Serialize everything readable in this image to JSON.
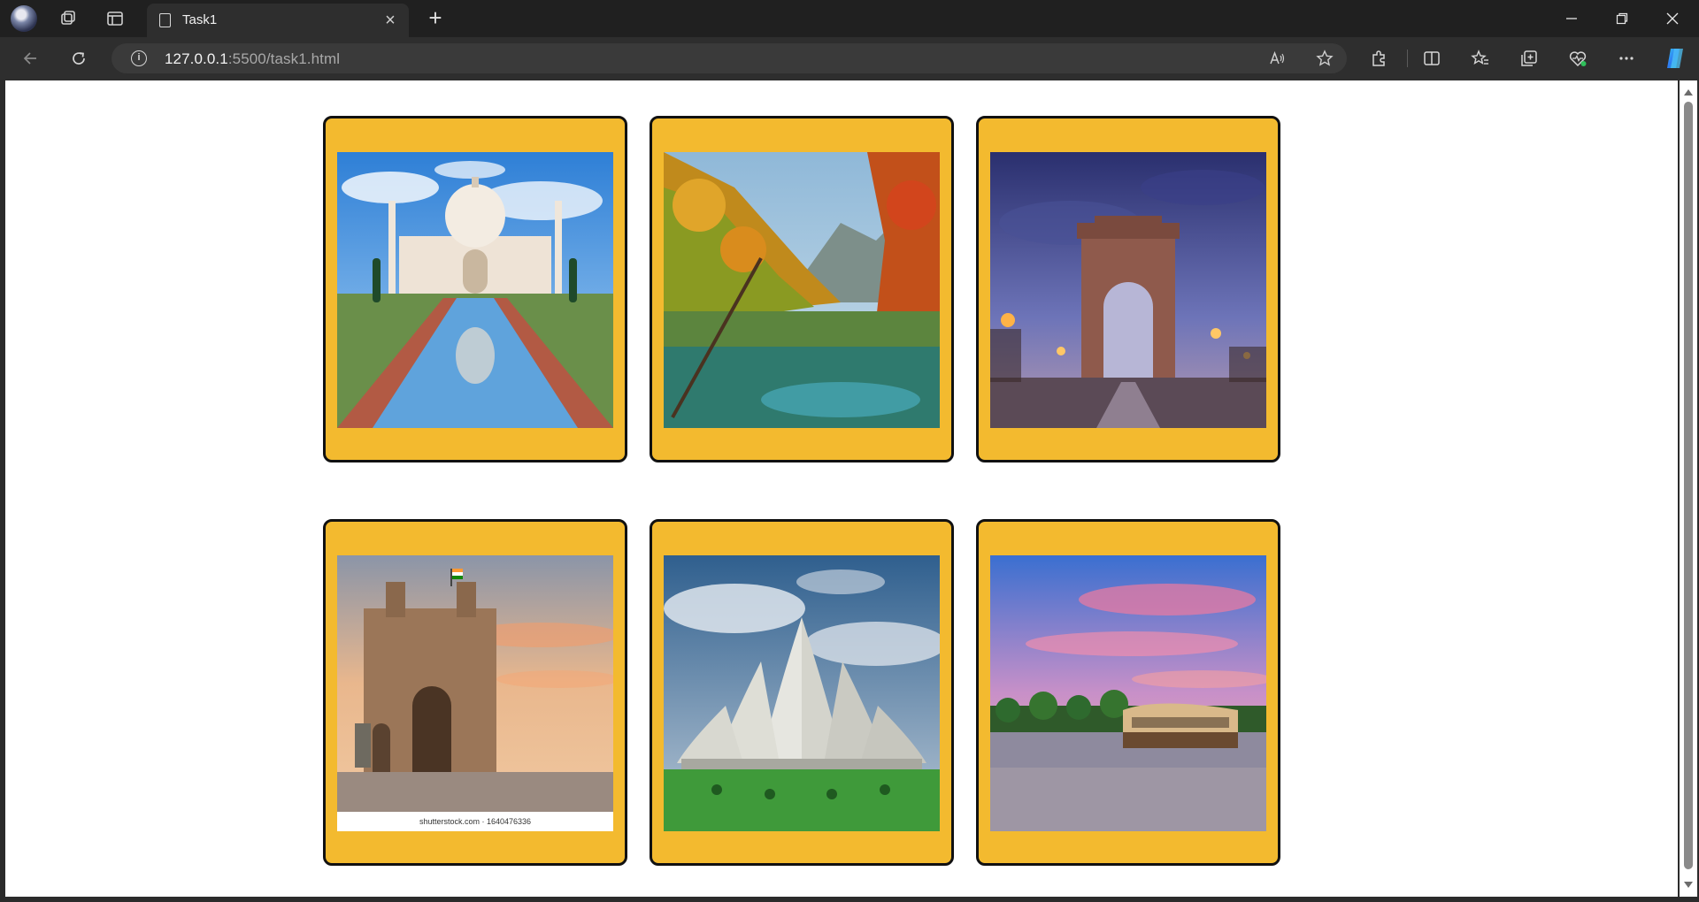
{
  "tab": {
    "title": "Task1"
  },
  "address": {
    "host": "127.0.0.1",
    "path": ":5500/task1.html"
  },
  "gallery": [
    {
      "subject": "Taj Mahal"
    },
    {
      "subject": "Autumn forest lake"
    },
    {
      "subject": "India Gate"
    },
    {
      "subject": "Gateway of India",
      "watermark": "shutterstock.com · 1640476336"
    },
    {
      "subject": "Lotus Temple"
    },
    {
      "subject": "Kerala backwater houseboat"
    }
  ],
  "colors": {
    "card_bg": "#f3ba2f",
    "card_border": "#111111",
    "page_bg": "#ffffff",
    "chrome_bg": "#202020"
  },
  "icons": [
    "profile-icon",
    "workspaces-icon",
    "tab-actions-icon",
    "page-icon",
    "close-icon",
    "plus-icon",
    "minimize-icon",
    "restore-icon",
    "close-window-icon",
    "back-arrow-icon",
    "refresh-icon",
    "info-icon",
    "read-aloud-icon",
    "star-icon",
    "extensions-icon",
    "split-screen-icon",
    "favorites-icon",
    "collections-icon",
    "browser-essentials-icon",
    "more-icon",
    "copilot-icon"
  ]
}
